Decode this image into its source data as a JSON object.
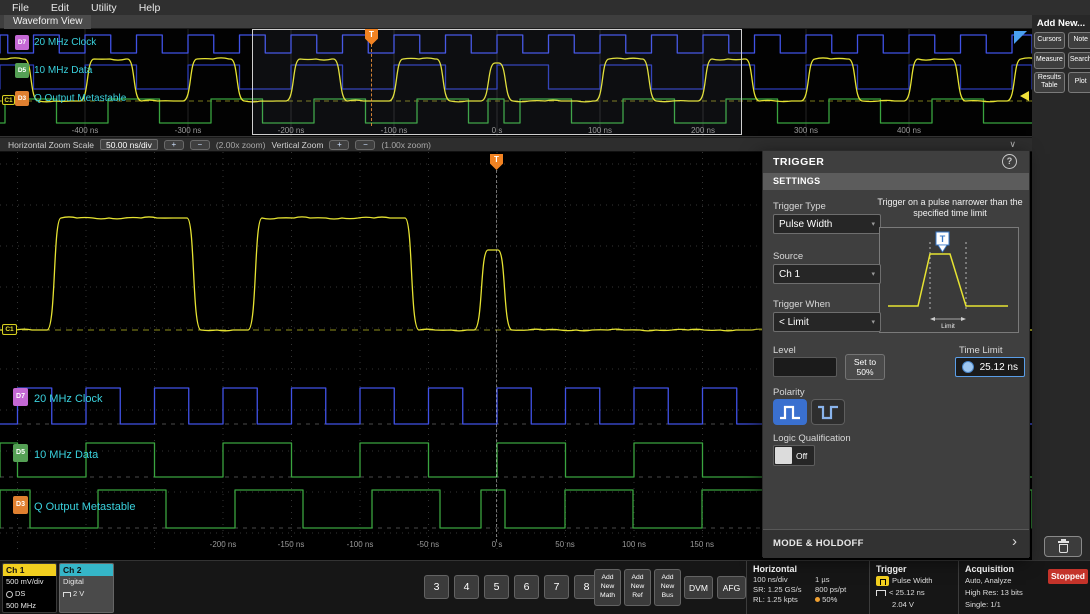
{
  "menubar": {
    "items": [
      "File",
      "Edit",
      "Utility",
      "Help"
    ]
  },
  "waveform_view": {
    "title": "Waveform View",
    "overview_axis": [
      "-400 ns",
      "-300 ns",
      "-200 ns",
      "-100 ns",
      "0 s",
      "100 ns",
      "200 ns",
      "300 ns",
      "400 ns"
    ],
    "main_axis": [
      "-200 ns",
      "-150 ns",
      "-100 ns",
      "-50 ns",
      "0 s",
      "50 ns",
      "100 ns",
      "150 ns"
    ],
    "ch1_marker": "C1"
  },
  "channels": [
    {
      "badge": "D7",
      "label": "20 MHz Clock",
      "color": "#c468d4"
    },
    {
      "badge": "D5",
      "label": "10 MHz Data",
      "color": "#55a055"
    },
    {
      "badge": "D3",
      "label": "Q Output Metastable",
      "color": "#e08030"
    }
  ],
  "add_new": {
    "title": "Add New...",
    "buttons": [
      "Cursors",
      "Note",
      "Measure",
      "Search",
      "Results Table",
      "Plot"
    ]
  },
  "zoom_bar": {
    "h_label": "Horizontal Zoom Scale",
    "h_value": "50.00 ns/div",
    "h_zoom": "(2.00x zoom)",
    "v_label": "Vertical Zoom",
    "v_zoom": "(1.00x zoom)"
  },
  "trigger_panel": {
    "title": "TRIGGER",
    "section": "SETTINGS",
    "trigger_type_label": "Trigger Type",
    "trigger_type_value": "Pulse Width",
    "description": "Trigger on a pulse narrower than the specified time limit",
    "source_label": "Source",
    "source_value": "Ch 1",
    "trigger_when_label": "Trigger When",
    "trigger_when_value": "< Limit",
    "level_label": "Level",
    "level_value": "2.04 V",
    "set_to_lines": [
      "Set to",
      "50%"
    ],
    "time_limit_label": "Time Limit",
    "time_limit_value": "25.12 ns",
    "polarity_label": "Polarity",
    "logic_label": "Logic Qualification",
    "logic_value": "Off",
    "diagram_limit": "Limit",
    "footer": "MODE & HOLDOFF"
  },
  "status_bar": {
    "ch1": {
      "name": "Ch 1",
      "scale": "500 mV/div",
      "probe": "DS",
      "bw": "500 MHz"
    },
    "ch2": {
      "name": "Ch 2",
      "mode": "Digital",
      "threshold": "2 V"
    },
    "channel_buttons": [
      "3",
      "4",
      "5",
      "6",
      "7",
      "8"
    ],
    "add_buttons": [
      [
        "Add",
        "New",
        "Math"
      ],
      [
        "Add",
        "New",
        "Ref"
      ],
      [
        "Add",
        "New",
        "Bus"
      ]
    ],
    "dvm": "DVM",
    "afg": "AFG",
    "horizontal": {
      "title": "Horizontal",
      "rows": [
        [
          "100 ns/div",
          "1 µs"
        ],
        [
          "SR: 1.25 GS/s",
          "800 ps/pt"
        ],
        [
          "RL: 1.25 kpts",
          "50%"
        ]
      ]
    },
    "trigger": {
      "title": "Trigger",
      "type": "Pulse Width",
      "limit": "< 25.12 ns",
      "level": "2.04 V"
    },
    "acquisition": {
      "title": "Acquisition",
      "rows": [
        "Auto,  Analyze",
        "High Res: 13 bits",
        "Single: 1/1"
      ]
    },
    "stopped": "Stopped"
  },
  "icons": {
    "plus": "+",
    "minus": "−",
    "caret": "▾",
    "help": "?",
    "chevron": "›",
    "collapse": "∨",
    "t": "T"
  },
  "colors": {
    "ch1_yellow": "#e6e332",
    "clock_blue": "#4052e6",
    "digital_green": "#3aa43f",
    "trigger_orange": "#f28322",
    "accent_blue": "#3a70cf",
    "stopped_red": "#c4332a",
    "label_cyan": "#3ad2de"
  }
}
